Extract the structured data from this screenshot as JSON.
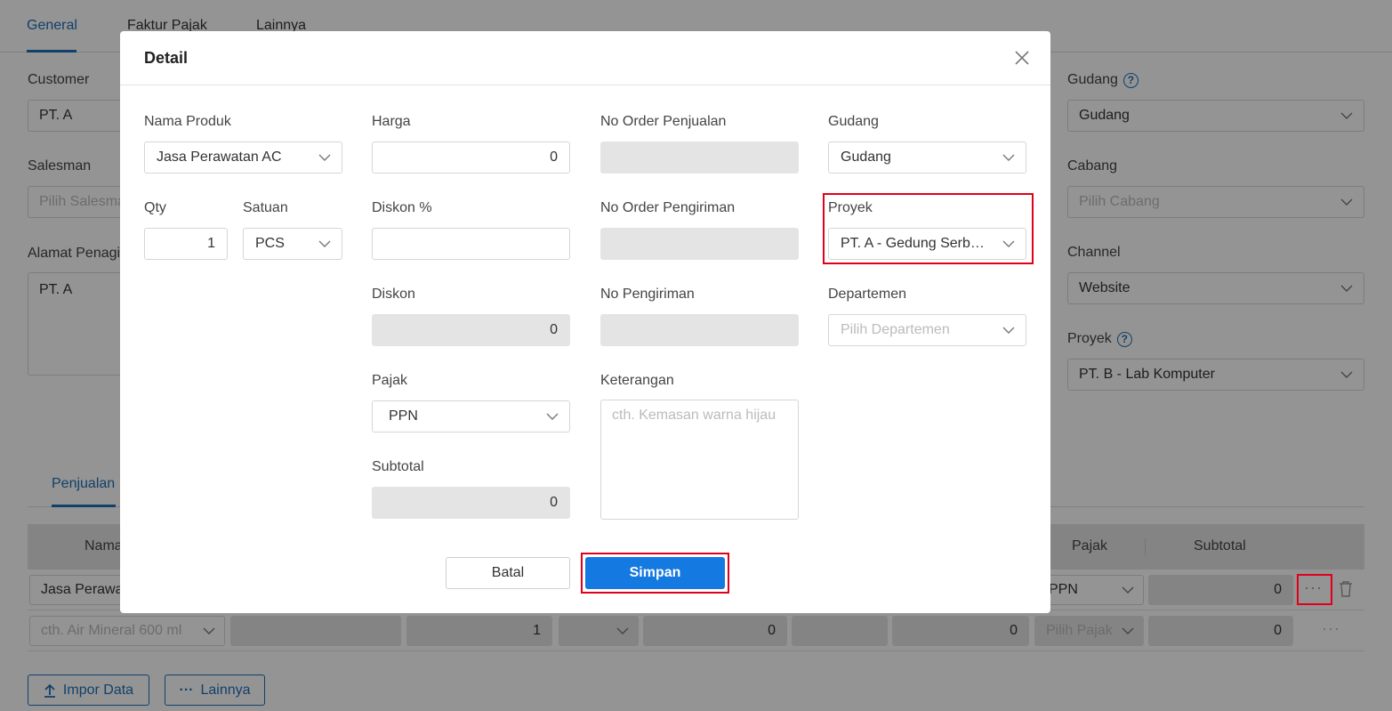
{
  "page": {
    "tabs": [
      "General",
      "Faktur Pajak",
      "Lainnya"
    ],
    "customer": {
      "label": "Customer",
      "value": "PT. A"
    },
    "salesman": {
      "label": "Salesman",
      "placeholder": "Pilih Salesman"
    },
    "alamat": {
      "label": "Alamat Penagihan",
      "value": "PT. A"
    },
    "gudang": {
      "label": "Gudang",
      "value": "Gudang"
    },
    "cabang": {
      "label": "Cabang",
      "placeholder": "Pilih Cabang"
    },
    "channel": {
      "label": "Channel",
      "value": "Website"
    },
    "proyek": {
      "label": "Proyek",
      "value": "PT. B - Lab Komputer"
    },
    "sub_tab": "Penjualan",
    "table": {
      "headers": {
        "nama": "Nama",
        "pajak": "Pajak",
        "subtotal": "Subtotal"
      },
      "row1": {
        "product": "Jasa Perawatan AC",
        "pajak": "PPN",
        "subtotal": "0"
      },
      "row2": {
        "product_placeholder": "cth. Air Mineral 600 ml",
        "qty": "1",
        "val1": "0",
        "val2": "0",
        "pajak_placeholder": "Pilih Pajak",
        "subtotal": "0"
      }
    },
    "buttons": {
      "impor": "Impor Data",
      "lainnya": "Lainnya"
    }
  },
  "modal": {
    "title": "Detail",
    "nama_produk": {
      "label": "Nama Produk",
      "value": "Jasa Perawatan AC"
    },
    "qty": {
      "label": "Qty",
      "value": "1"
    },
    "satuan": {
      "label": "Satuan",
      "value": "PCS"
    },
    "harga": {
      "label": "Harga",
      "value": "0"
    },
    "diskon_persen": {
      "label": "Diskon %",
      "value": ""
    },
    "diskon": {
      "label": "Diskon",
      "value": "0"
    },
    "pajak": {
      "label": "Pajak",
      "value": "PPN"
    },
    "subtotal": {
      "label": "Subtotal",
      "value": "0"
    },
    "no_order_penjualan": {
      "label": "No Order Penjualan",
      "value": ""
    },
    "no_order_pengiriman": {
      "label": "No Order Pengiriman",
      "value": ""
    },
    "no_pengiriman": {
      "label": "No Pengiriman",
      "value": ""
    },
    "keterangan": {
      "label": "Keterangan",
      "placeholder": "cth. Kemasan warna hijau"
    },
    "gudang": {
      "label": "Gudang",
      "value": "Gudang"
    },
    "proyek": {
      "label": "Proyek",
      "value": "PT. A - Gedung Serbaguna"
    },
    "departemen": {
      "label": "Departemen",
      "placeholder": "Pilih Departemen"
    },
    "buttons": {
      "batal": "Batal",
      "simpan": "Simpan"
    }
  },
  "colors": {
    "accent": "#1f6fb5",
    "primary_button": "#1479e0",
    "highlight": "#e0001b"
  }
}
